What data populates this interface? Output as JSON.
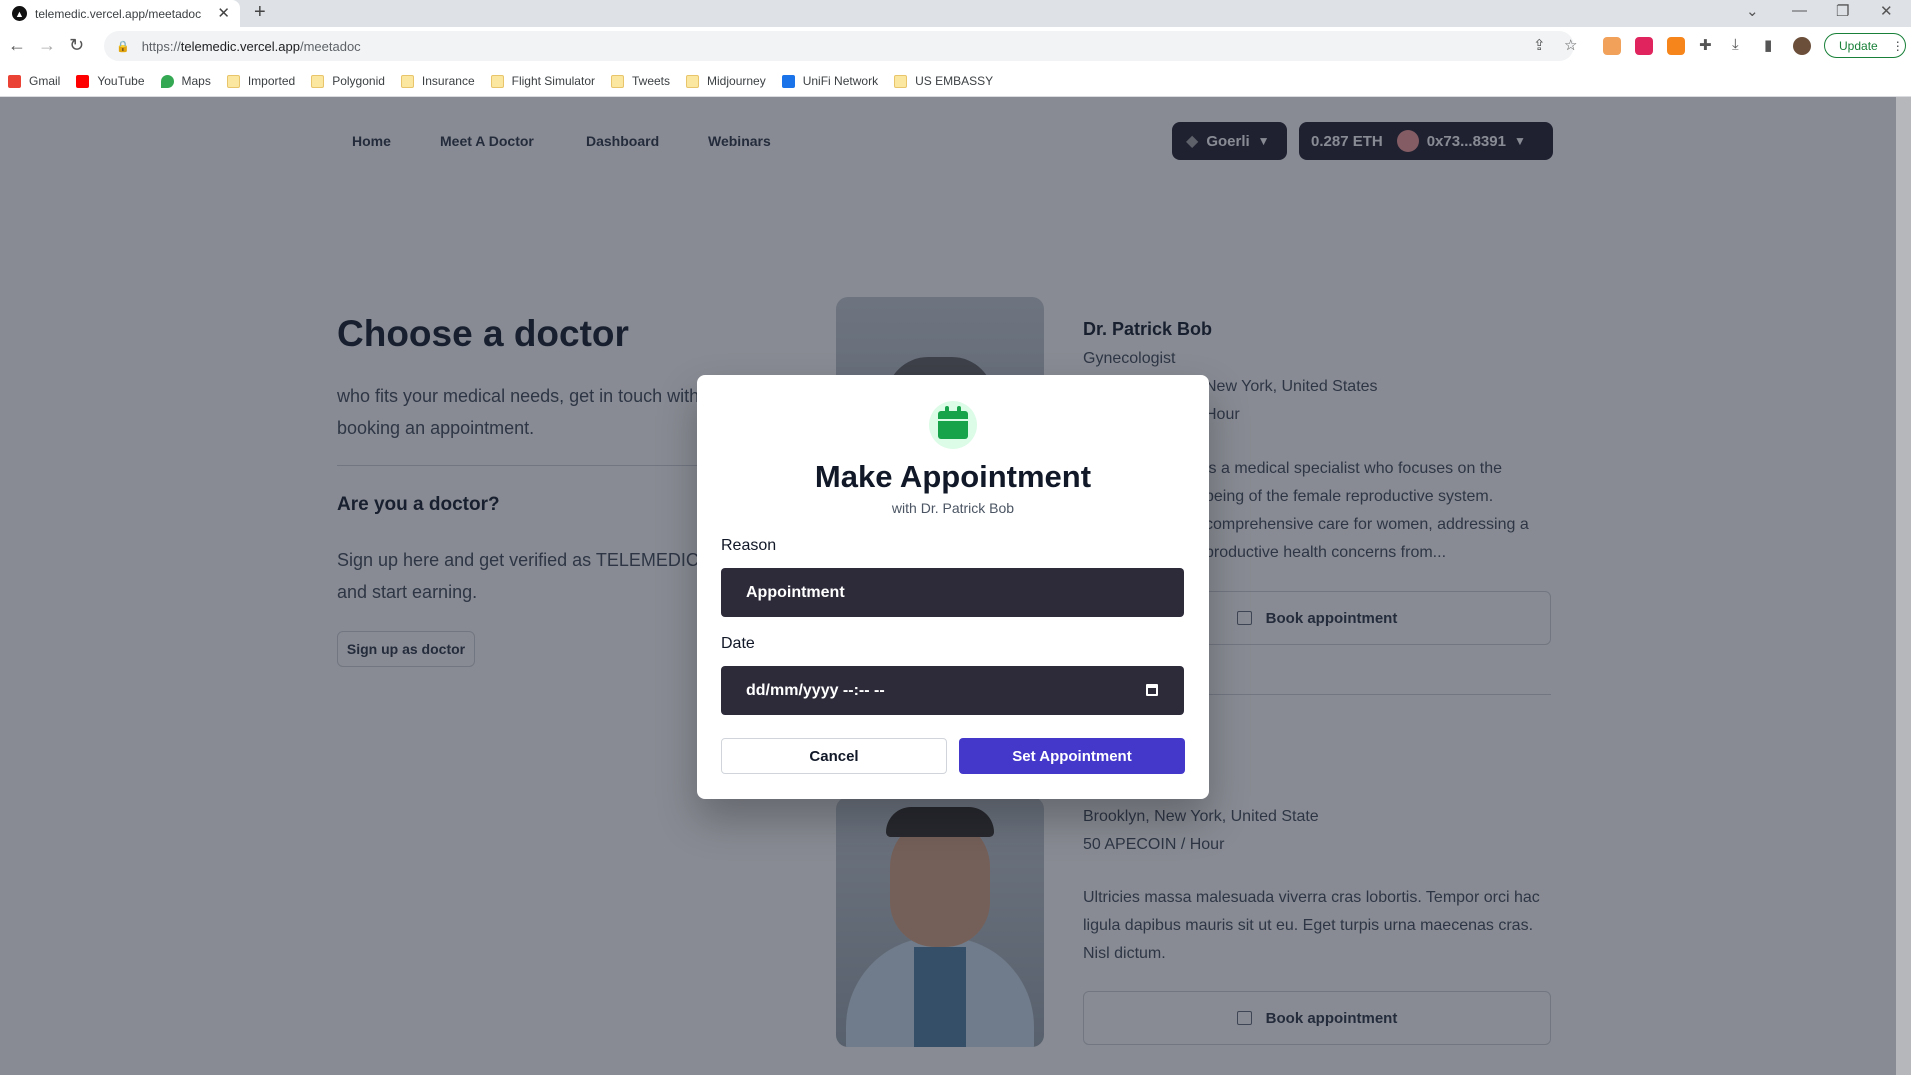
{
  "browser": {
    "tab_title": "telemedic.vercel.app/meetadoc",
    "url_scheme": "https://",
    "url_host": "telemedic.vercel.app",
    "url_path": "/meetadoc",
    "update_label": "Update",
    "bookmarks": [
      "Gmail",
      "YouTube",
      "Maps",
      "Imported",
      "Polygonid",
      "Insurance",
      "Flight Simulator",
      "Tweets",
      "Midjourney",
      "UniFi Network",
      "US EMBASSY"
    ]
  },
  "nav": {
    "links": [
      "Home",
      "Meet A Doctor",
      "Dashboard",
      "Webinars"
    ],
    "network": "Goerli",
    "balance": "0.287 ETH",
    "address": "0x73...8391"
  },
  "hero": {
    "title": "Choose a doctor",
    "text": "who fits your medical needs, get in touch with simply booking an appointment.",
    "doctor_question": "Are you a doctor?",
    "doctor_text": "Sign up here and get verified as TELEMEDIC doctor and start earning.",
    "signup_label": "Sign up as doctor"
  },
  "doctors": [
    {
      "name": "Dr. Patrick Bob",
      "specialty": "Gynecologist",
      "location": "New York, United States",
      "rate": "Hour",
      "description": "is a medical specialist who focuses on the being of the female reproductive system. comprehensive care for women, addressing a productive health concerns from...",
      "book_label": "Book appointment"
    },
    {
      "location": "Brooklyn, New York, United State",
      "rate": "50 APECOIN / Hour",
      "description": "Ultricies massa malesuada viverra cras lobortis. Tempor orci hac ligula dapibus mauris sit ut eu. Eget turpis urna maecenas cras. Nisl dictum.",
      "book_label": "Book appointment"
    }
  ],
  "modal": {
    "icon": "calendar-icon",
    "title": "Make Appointment",
    "subtitle": "with Dr. Patrick Bob",
    "reason_label": "Reason",
    "reason_value": "Appointment",
    "date_label": "Date",
    "date_placeholder": "dd/mm/yyyy --:-- --",
    "cancel_label": "Cancel",
    "submit_label": "Set Appointment"
  },
  "colors": {
    "primary": "#4338ca",
    "field_bg": "#2d2b3a",
    "icon_green": "#16a34a",
    "overlay": "rgba(17,24,39,0.5)"
  }
}
